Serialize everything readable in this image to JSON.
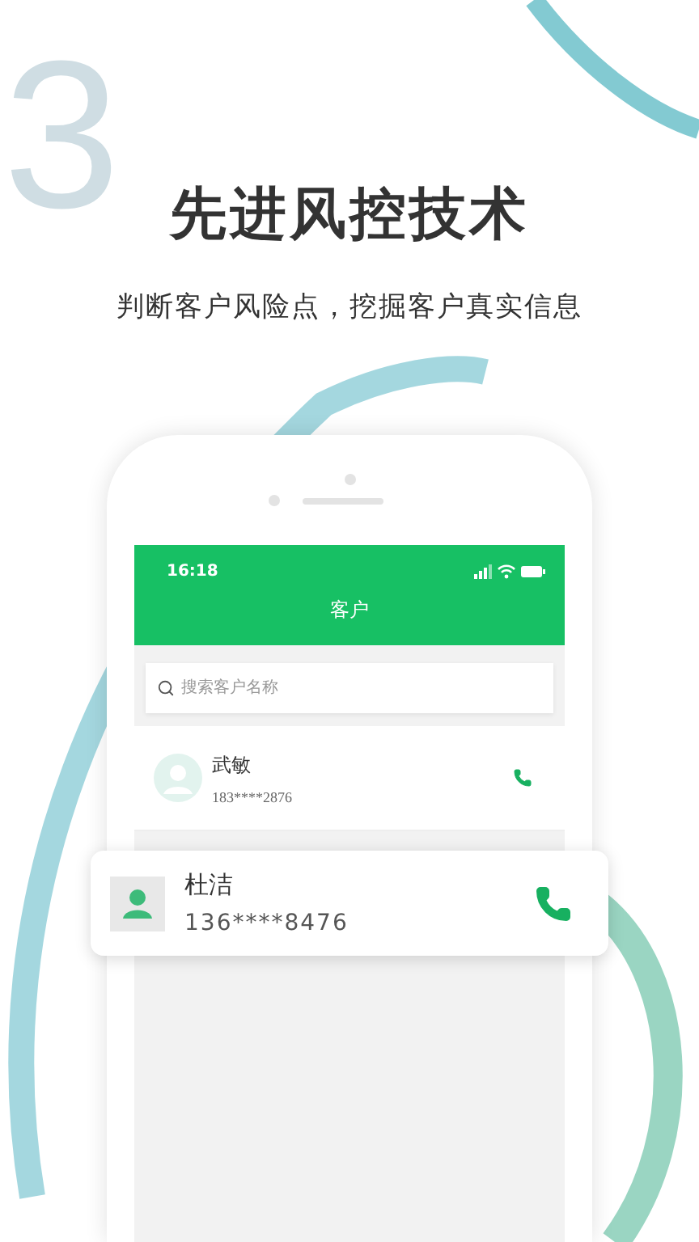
{
  "badge": {
    "number": "3"
  },
  "headline": "先进风控技术",
  "subtitle": "判断客户风险点，挖掘客户真实信息",
  "phone": {
    "status_bar": {
      "time": "16:18"
    },
    "nav_title": "客户",
    "search": {
      "placeholder": "搜索客户名称"
    },
    "customers": [
      {
        "name": "武敏",
        "phone": "183****2876",
        "kind": "row"
      },
      {
        "name": "杜洁",
        "phone": "136****8476",
        "kind": "popout"
      }
    ]
  }
}
